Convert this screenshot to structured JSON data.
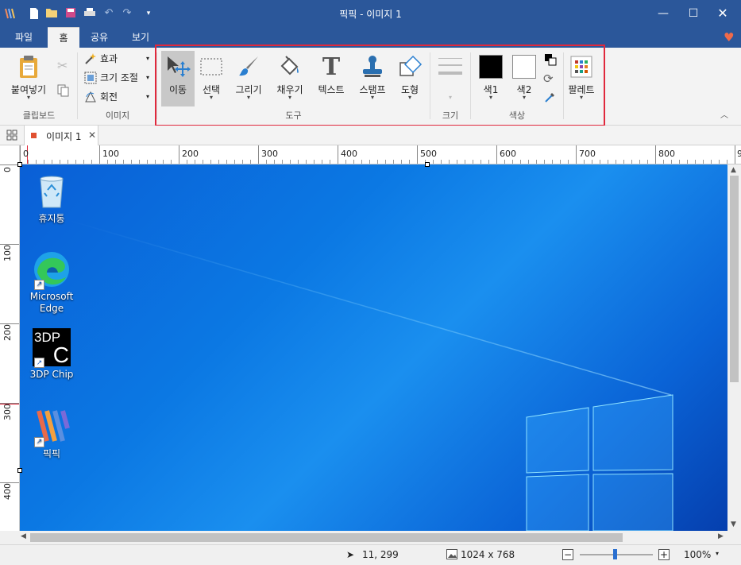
{
  "window": {
    "title": "픽픽 - 이미지 1"
  },
  "menu_tabs": [
    "파일",
    "홈",
    "공유",
    "보기"
  ],
  "ribbon": {
    "clipboard": {
      "paste": "붙여넣기",
      "group": "클립보드"
    },
    "image": {
      "effects": "효과",
      "resize": "크기 조절",
      "rotate": "회전",
      "group": "이미지"
    },
    "tools": {
      "move": "이동",
      "select": "선택",
      "draw": "그리기",
      "fill": "채우기",
      "text": "텍스트",
      "stamp": "스탬프",
      "shape": "도형",
      "group": "도구"
    },
    "size": {
      "group": "크기"
    },
    "colors": {
      "color1": "색1",
      "color2": "색2",
      "group": "색상",
      "color1_value": "#000000",
      "color2_value": "#ffffff"
    },
    "palette": {
      "label": "팔레트"
    }
  },
  "doc_tab": {
    "label": "이미지 1"
  },
  "ruler_top": [
    "0",
    "100",
    "200",
    "300",
    "400",
    "500",
    "600",
    "700",
    "800",
    "9"
  ],
  "ruler_left": [
    "0",
    "100",
    "200",
    "300",
    "400"
  ],
  "desktop_icons": [
    {
      "label": "휴지통"
    },
    {
      "label": "Microsoft Edge"
    },
    {
      "label": "3DP Chip"
    },
    {
      "label": "픽픽"
    }
  ],
  "chip_icon_text": {
    "line1": "3DP",
    "line2": "C"
  },
  "status": {
    "cursor": "11, 299",
    "image_size": "1024 x 768",
    "zoom": "100%"
  },
  "accent": "#2b579a",
  "highlight_color": "#e0283c"
}
